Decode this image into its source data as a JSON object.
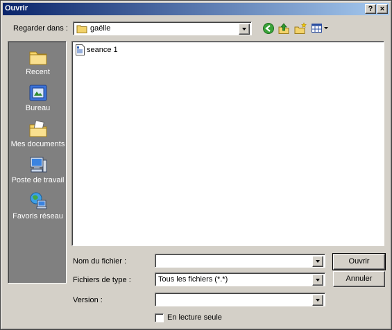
{
  "window": {
    "title": "Ouvrir",
    "help_button": "?",
    "close_button": "×"
  },
  "look_in": {
    "label": "Regarder dans :",
    "value": "gaëlle"
  },
  "toolbar": {
    "icons": [
      "back-icon",
      "up-folder-icon",
      "new-folder-icon",
      "view-menu-icon"
    ]
  },
  "places": [
    {
      "label": "Recent",
      "icon": "recent-folder-icon"
    },
    {
      "label": "Bureau",
      "icon": "desktop-icon"
    },
    {
      "label": "Mes documents",
      "icon": "my-documents-icon"
    },
    {
      "label": "Poste de travail",
      "icon": "my-computer-icon"
    },
    {
      "label": "Favoris réseau",
      "icon": "network-places-icon"
    }
  ],
  "files": [
    {
      "name": "seance 1",
      "icon": "document-icon"
    }
  ],
  "form": {
    "filename_label": "Nom du fichier :",
    "filename_value": "",
    "filetype_label": "Fichiers de type :",
    "filetype_value": "Tous les fichiers (*.*)",
    "version_label": "Version :",
    "version_value": "",
    "readonly_label": "En lecture seule"
  },
  "buttons": {
    "open": "Ouvrir",
    "cancel": "Annuler"
  },
  "colors": {
    "title_start": "#0a246a",
    "title_end": "#a6caf0",
    "face": "#d4d0c8",
    "places_bg": "#808080"
  }
}
